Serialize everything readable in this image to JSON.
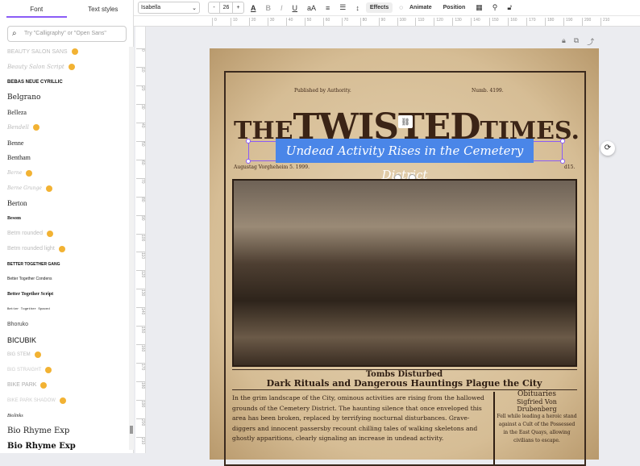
{
  "left_panel": {
    "tabs": [
      "Font",
      "Text styles"
    ],
    "search_placeholder": "Try \"Calligraphy\" or \"Open Sans\"",
    "fonts": [
      {
        "name": "BEAUTY SALON SANS",
        "pro": true
      },
      {
        "name": "Beauty Salon Script",
        "pro": true
      },
      {
        "name": "BEBAS NEUE CYRILLIC",
        "pro": false
      },
      {
        "name": "Belgrano",
        "pro": false
      },
      {
        "name": "Belleza",
        "pro": false
      },
      {
        "name": "Bendell",
        "pro": true
      },
      {
        "name": "Benne",
        "pro": false
      },
      {
        "name": "Bentham",
        "pro": false
      },
      {
        "name": "Berne",
        "pro": true
      },
      {
        "name": "Berne Grunge",
        "pro": true
      },
      {
        "name": "Berton",
        "pro": false
      },
      {
        "name": "Besom",
        "pro": false
      },
      {
        "name": "Betm rounded",
        "pro": true
      },
      {
        "name": "Betm rounded light",
        "pro": true
      },
      {
        "name": "BETTER TOGETHER GANG",
        "pro": false
      },
      {
        "name": "Better Together Condens",
        "pro": false
      },
      {
        "name": "Better Together Script",
        "pro": false
      },
      {
        "name": "Better Together Spaced",
        "pro": false
      },
      {
        "name": "Bhoruko",
        "pro": false
      },
      {
        "name": "BICUBIK",
        "pro": false
      },
      {
        "name": "BIG STEM",
        "pro": true
      },
      {
        "name": "BIG STRAIGHT",
        "pro": true
      },
      {
        "name": "BIKE PARK",
        "pro": true
      },
      {
        "name": "BIKE PARK SHADOW",
        "pro": true
      },
      {
        "name": "Biolinks",
        "pro": false
      },
      {
        "name": "Bio Rhyme Exp",
        "pro": false
      },
      {
        "name": "Bio Rhyme Exp",
        "pro": false
      }
    ]
  },
  "toolbar": {
    "font": "Isabella",
    "size": "26",
    "minus": "-",
    "plus": "+",
    "effects": "Effects",
    "animate": "Animate",
    "position": "Position"
  },
  "ruler": {
    "h": [
      "0",
      "10",
      "20",
      "30",
      "40",
      "50",
      "60",
      "70",
      "80",
      "90",
      "100",
      "110",
      "120",
      "130",
      "140",
      "150",
      "160",
      "170",
      "180",
      "190",
      "200",
      "210"
    ],
    "v": [
      "0",
      "10",
      "20",
      "30",
      "40",
      "50",
      "60",
      "70",
      "80",
      "90",
      "100",
      "110",
      "120",
      "130",
      "140",
      "150",
      "160",
      "170",
      "180",
      "190",
      "200",
      "210"
    ]
  },
  "newspaper": {
    "published": "Published by Authority.",
    "number": "Numb. 4199.",
    "title_the": "THE",
    "title_twisted": "TWISTED",
    "title_times": "TIMES.",
    "date": "Augustag Vorgheheim 5. 1999.",
    "price": "d15.",
    "headline": "Undead Activity Rises in the Cemetery District",
    "sub1": "Tombs Disturbed",
    "sub2": "Dark Rituals and Dangerous Hauntings Plague the City",
    "body": "In the grim landscape of the City, ominous activities are rising from the hallowed grounds of the Cemetery District. The haunting silence that once enveloped this area has been broken, replaced by terrifying nocturnal disturbances. Grave-diggers and innocent passersby recount chilling tales of walking skeletons and ghostly apparitions, clearly signaling an increase in undead activity.",
    "obit_title": "Obituaries",
    "obit_name": "Sigfried Von Drubenberg",
    "obit_text": "Fell while leading a heroic stand against a Cult of the Possessed in the East Quays, allowing civilians to escape."
  }
}
